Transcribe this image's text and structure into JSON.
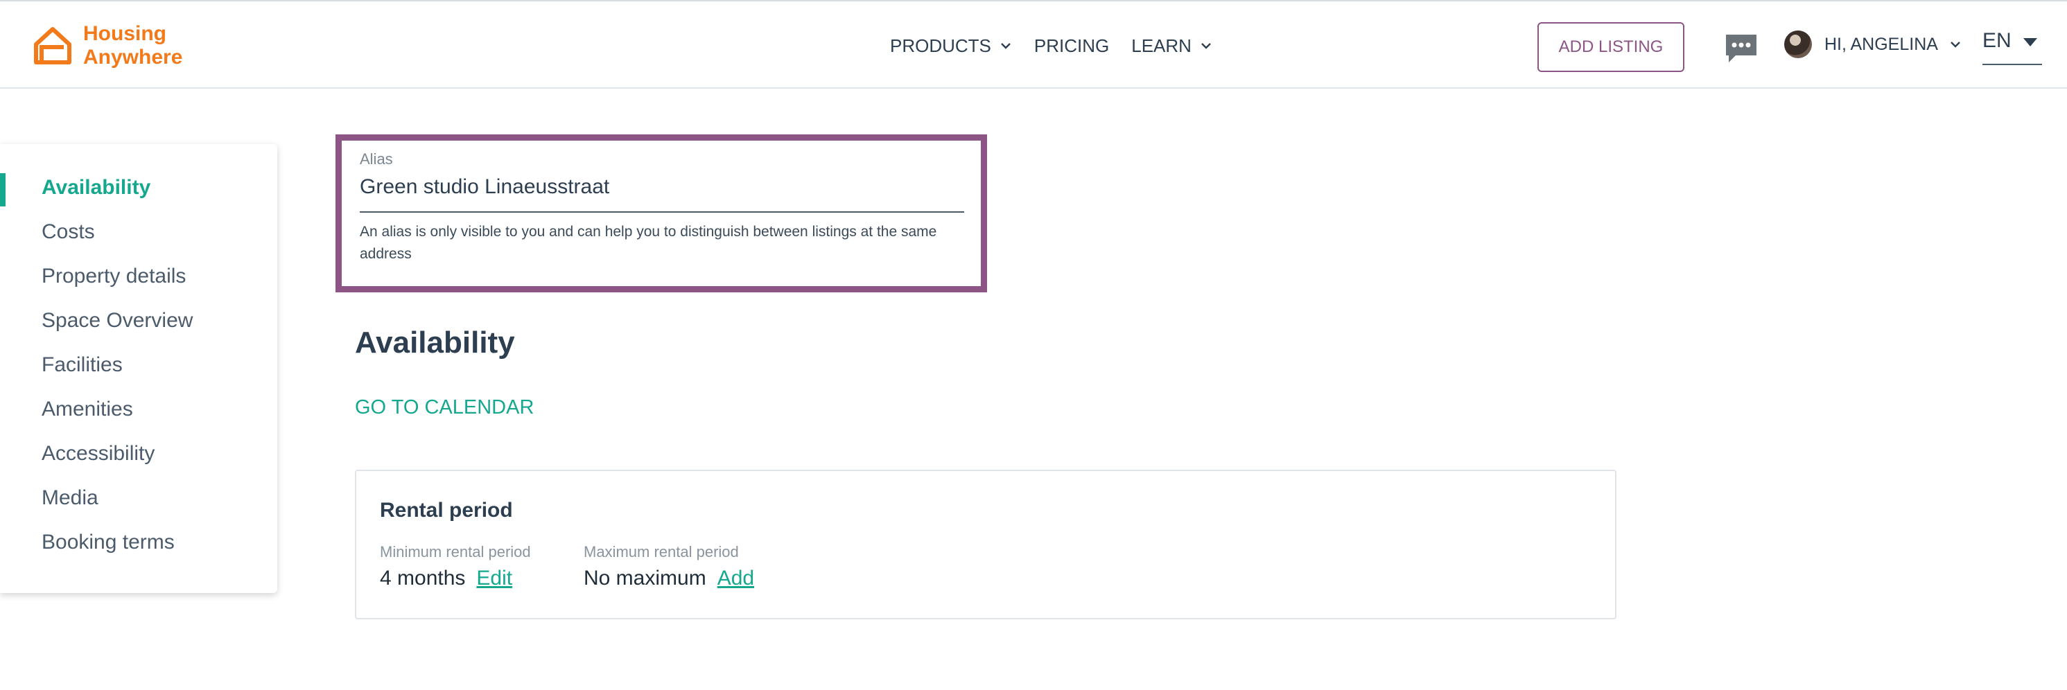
{
  "brand": {
    "logo_line1": "Housing",
    "logo_line2": "Anywhere",
    "accent": "#16a88f",
    "brand_orange": "#f27a1a",
    "highlight": "#8c5585"
  },
  "header": {
    "nav": [
      {
        "label": "PRODUCTS",
        "has_dropdown": true
      },
      {
        "label": "PRICING",
        "has_dropdown": false
      },
      {
        "label": "LEARN",
        "has_dropdown": true
      }
    ],
    "add_listing": "ADD LISTING",
    "chat_icon": "chat-bubble-icon",
    "user_greeting": "HI, ANGELINA",
    "language": "EN"
  },
  "sidebar": {
    "items": [
      {
        "label": "Availability",
        "active": true
      },
      {
        "label": "Costs"
      },
      {
        "label": "Property details"
      },
      {
        "label": "Space Overview"
      },
      {
        "label": "Facilities"
      },
      {
        "label": "Amenities"
      },
      {
        "label": "Accessibility"
      },
      {
        "label": "Media"
      },
      {
        "label": "Booking terms"
      }
    ]
  },
  "alias": {
    "label": "Alias",
    "value": "Green studio Linaeusstraat",
    "help": "An alias is only visible to you and can help you to distinguish between listings at the same address"
  },
  "availability": {
    "title": "Availability",
    "calendar_link": "GO TO CALENDAR",
    "rental_period": {
      "title": "Rental period",
      "min_label": "Minimum rental period",
      "min_value": "4 months",
      "min_action": "Edit",
      "max_label": "Maximum rental period",
      "max_value": "No maximum",
      "max_action": "Add"
    }
  }
}
